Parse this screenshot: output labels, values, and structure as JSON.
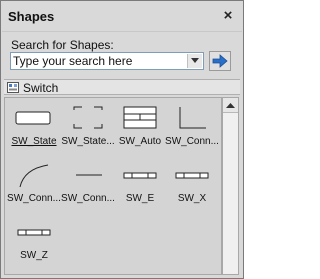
{
  "panel": {
    "title": "Shapes",
    "close_glyph": "×"
  },
  "search": {
    "label": "Search for Shapes:",
    "placeholder": "Type your search here"
  },
  "switch": {
    "label": "Switch"
  },
  "shapes": [
    {
      "label": "SW_State",
      "icon": "state-shape-icon",
      "selected": true
    },
    {
      "label": "SW_State...",
      "icon": "state-bracket-shape-icon"
    },
    {
      "label": "SW_Auto",
      "icon": "auto-shape-icon"
    },
    {
      "label": "SW_Conn...",
      "icon": "elbow-connector-icon"
    },
    {
      "label": "SW_Conn...",
      "icon": "curved-connector-icon"
    },
    {
      "label": "SW_Conn...",
      "icon": "straight-connector-icon"
    },
    {
      "label": "SW_E",
      "icon": "e-bar-shape-icon"
    },
    {
      "label": "SW_X",
      "icon": "x-bar-shape-icon"
    },
    {
      "label": "SW_Z",
      "icon": "z-bar-shape-icon"
    }
  ],
  "colors": {
    "accent_arrow": "#2a6fc9"
  }
}
